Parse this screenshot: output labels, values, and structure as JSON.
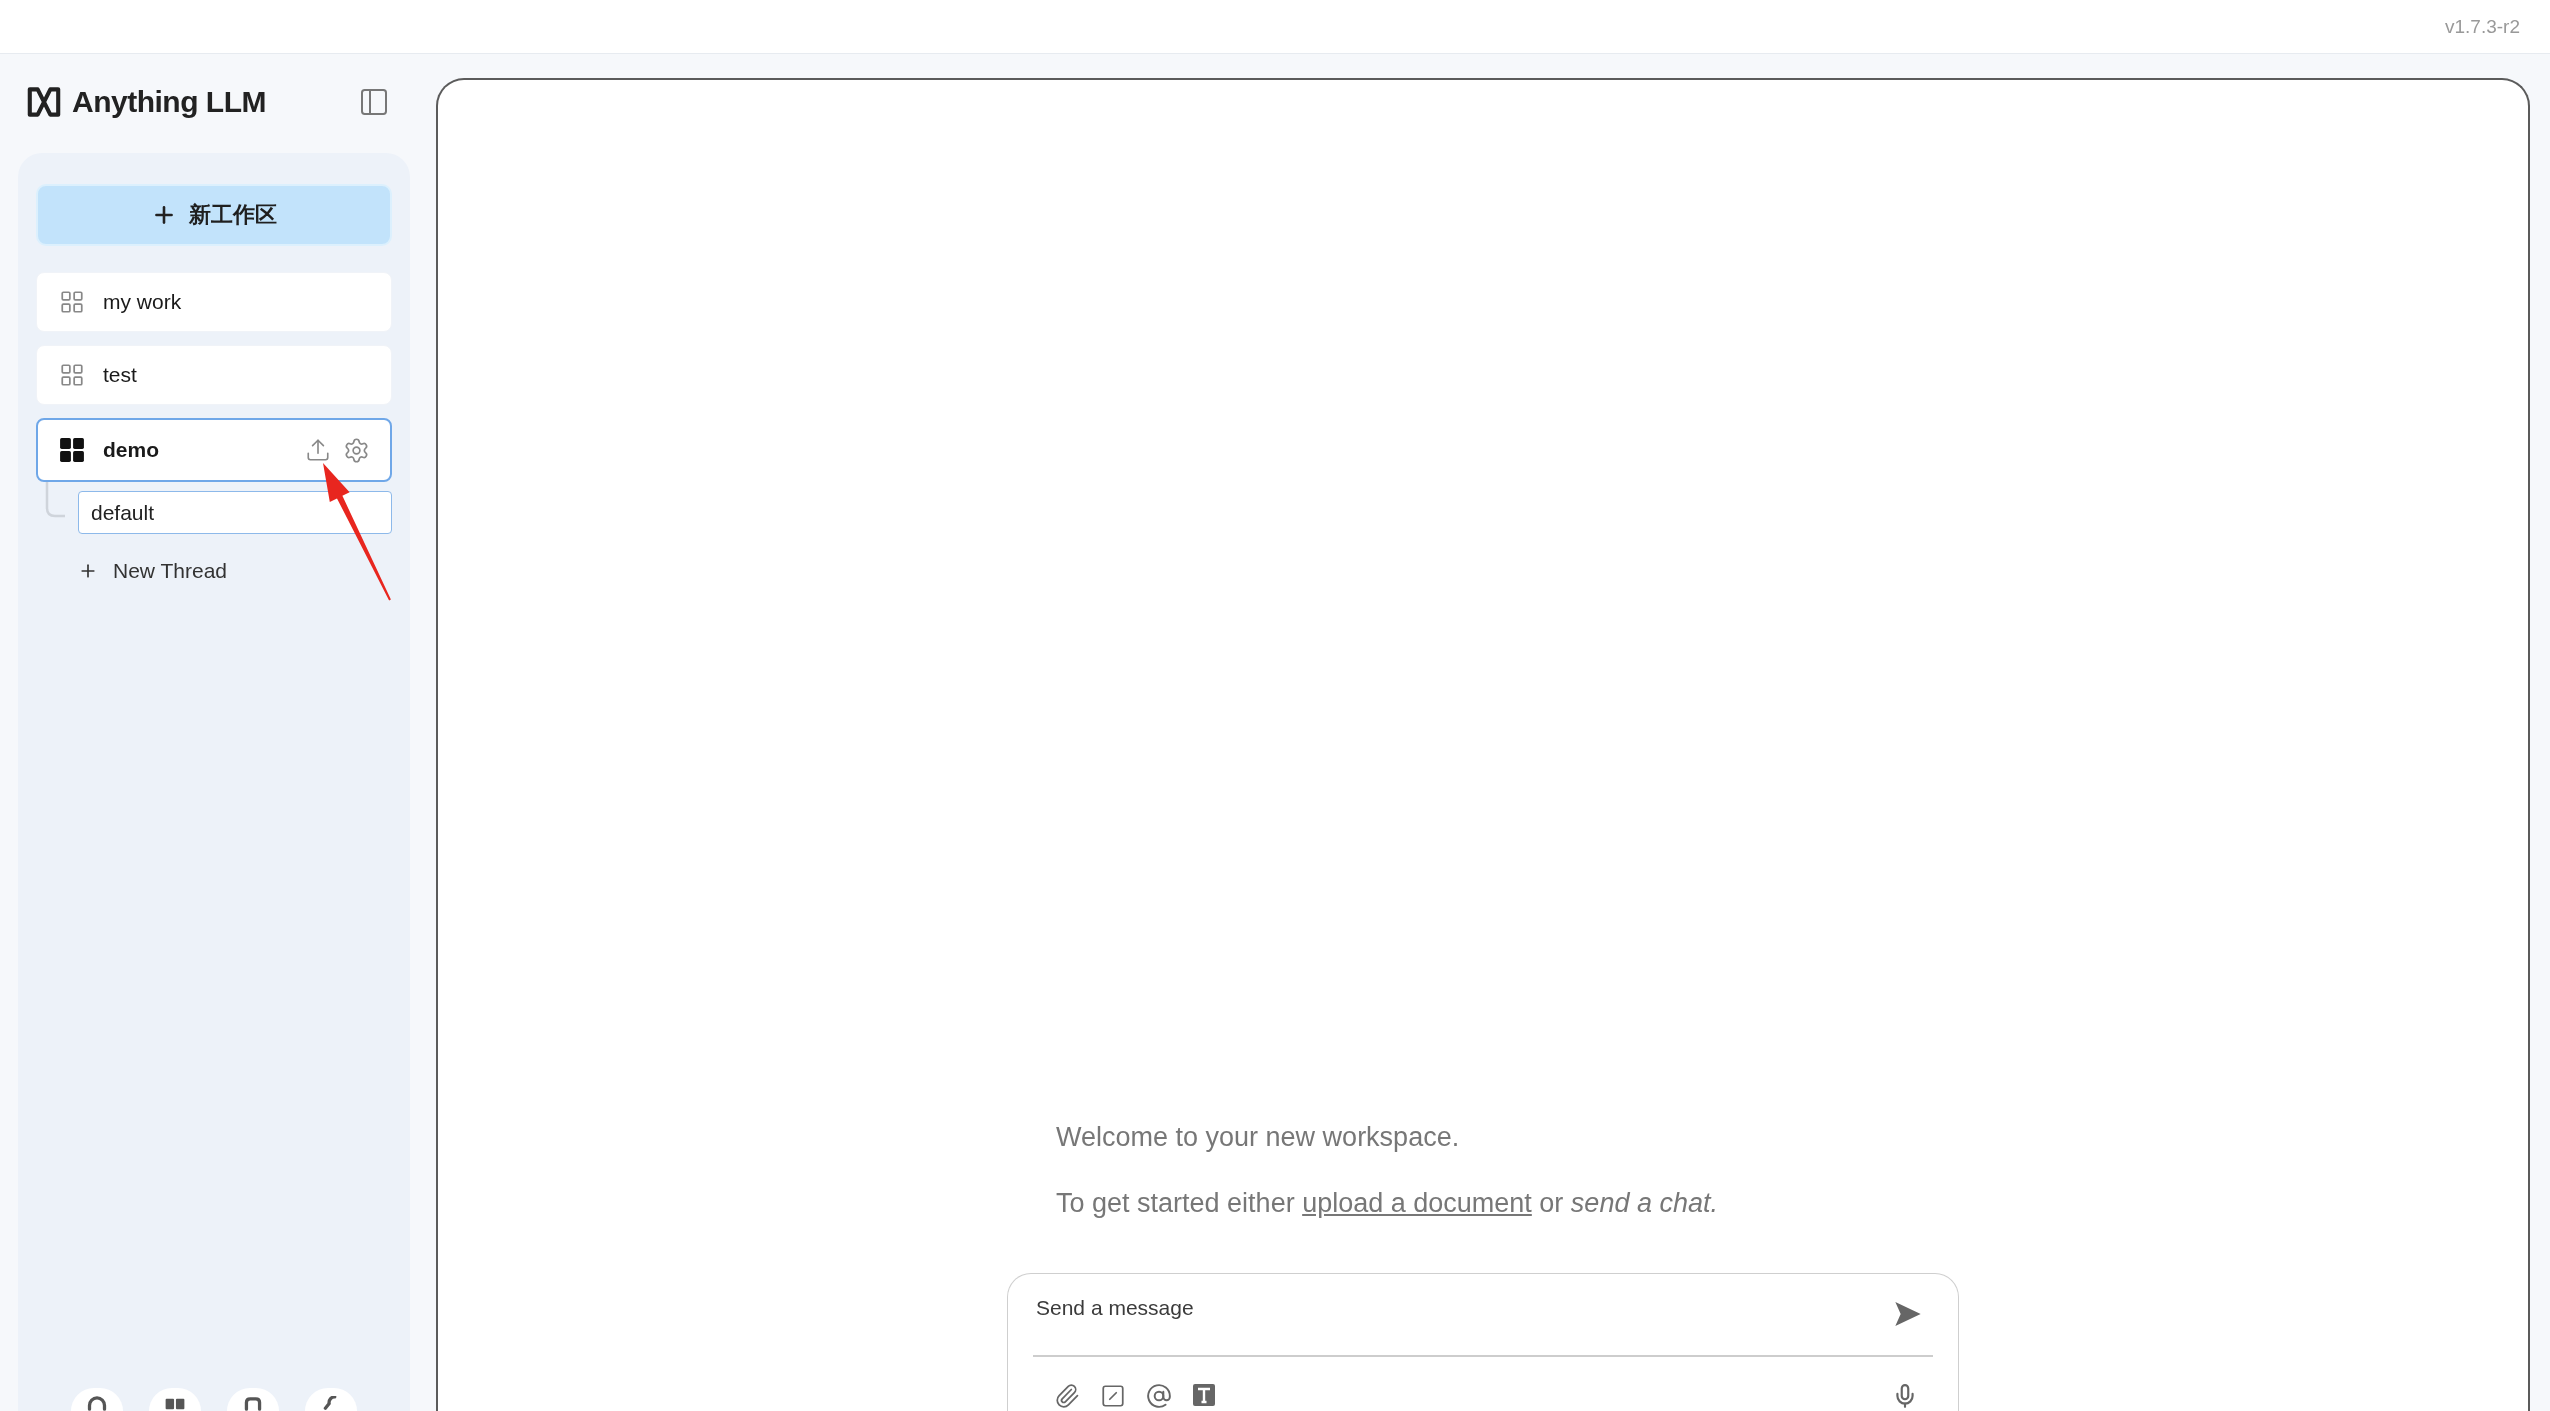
{
  "version": "v1.7.3-r2",
  "sidebar": {
    "logo": "Anything LLM",
    "new_workspace_button": "新工作区",
    "workspaces": [
      {
        "name": "my work",
        "selected": false
      },
      {
        "name": "test",
        "selected": false
      },
      {
        "name": "demo",
        "selected": true,
        "threads": [
          {
            "name": "default",
            "selected": true
          }
        ],
        "new_thread_button": "New Thread"
      }
    ]
  },
  "chat": {
    "welcome": "Welcome to your new workspace.",
    "getting_started": {
      "before": "To get started either",
      "link": "upload a document",
      "after": "or *send a chat.*"
    },
    "input": {
      "placeholder": "Send a message"
    }
  },
  "annotations": [
    {
      "kind": "arrow"
    }
  ]
}
